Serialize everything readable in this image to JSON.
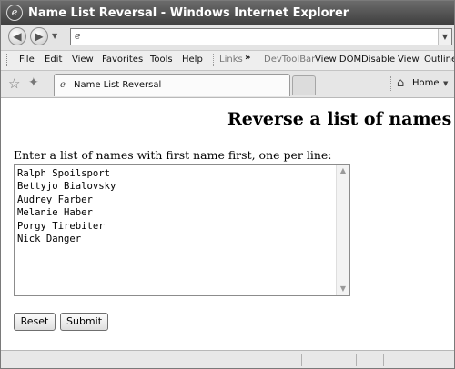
{
  "window": {
    "title": "Name List Reversal - Windows Internet Explorer"
  },
  "address_bar": {
    "value": ""
  },
  "menu": {
    "items": [
      "File",
      "Edit",
      "View",
      "Favorites",
      "Tools",
      "Help"
    ],
    "links_label": "Links",
    "chevron": "»",
    "devtoolbar_label": "DevToolBar",
    "devtoolbar_items": [
      "View DOM",
      "Disable",
      "View",
      "Outline"
    ]
  },
  "tabs": {
    "active_label": "Name List Reversal",
    "home_label": "Home"
  },
  "page": {
    "heading": "Reverse a list of names",
    "prompt": "Enter a list of names with first name first, one per line:",
    "names_text": "Ralph Spoilsport\nBettyjo Bialovsky\nAudrey Farber\nMelanie Haber\nPorgy Tirebiter\nNick Danger",
    "reset_label": "Reset",
    "submit_label": "Submit"
  },
  "icons": {
    "app": "ie-logo-icon",
    "back": "back-arrow-icon",
    "forward": "forward-arrow-icon",
    "page": "page-icon",
    "favorites": "favorites-star-icon",
    "add_favorite": "add-favorites-icon",
    "home": "home-icon"
  }
}
